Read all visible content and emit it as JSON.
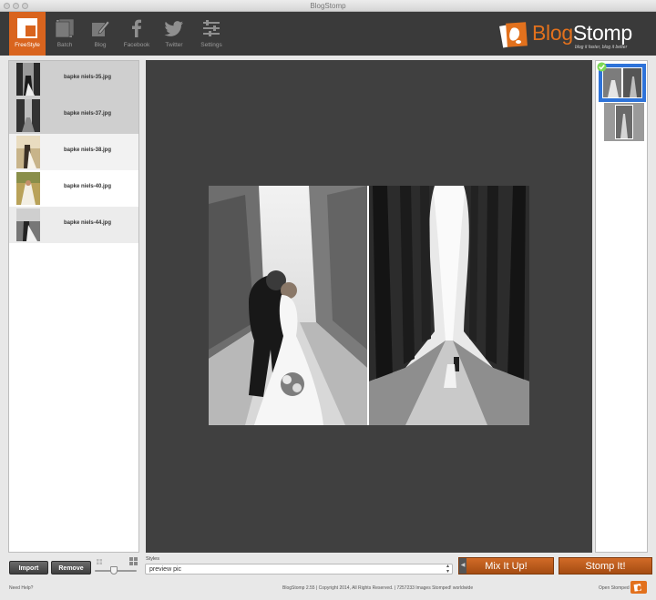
{
  "window": {
    "title": "BlogStomp"
  },
  "toolbar": {
    "items": [
      {
        "label": "FreeStyle",
        "icon": "freestyle-layout-icon",
        "active": true
      },
      {
        "label": "Batch",
        "icon": "batch-stack-icon",
        "active": false
      },
      {
        "label": "Blog",
        "icon": "blog-pencil-icon",
        "active": false
      },
      {
        "label": "Facebook",
        "icon": "facebook-icon",
        "active": false
      },
      {
        "label": "Twitter",
        "icon": "twitter-bird-icon",
        "active": false
      },
      {
        "label": "Settings",
        "icon": "settings-sliders-icon",
        "active": false
      }
    ],
    "brand_part1": "Blog",
    "brand_part2": "Stomp",
    "brand_tagline": "blog it faster, blog it better"
  },
  "files": [
    {
      "name": "bapke niels-35.jpg",
      "selected": true
    },
    {
      "name": "bapke niels-37.jpg",
      "selected": true
    },
    {
      "name": "bapke niels-38.jpg",
      "selected": false
    },
    {
      "name": "bapke niels-40.jpg",
      "selected": false
    },
    {
      "name": "bapke niels-44.jpg",
      "selected": false
    }
  ],
  "bottom": {
    "import_label": "Import",
    "remove_label": "Remove",
    "styles_label": "Styles",
    "styles_value": "preview pic",
    "mix_label": "Mix It Up!",
    "stomp_label": "Stomp It!"
  },
  "status": {
    "help": "Need Help?",
    "copyright": "BlogStomp 2.55 | Copyright 2014, All Rights Reserved. | 7257233 Images Stomped! worldwide",
    "open_stomped": "Open Stomped"
  },
  "colors": {
    "accent": "#d9641e",
    "toolbar": "#3a3a3a",
    "canvas": "#404040",
    "selection": "#2e73d9"
  }
}
